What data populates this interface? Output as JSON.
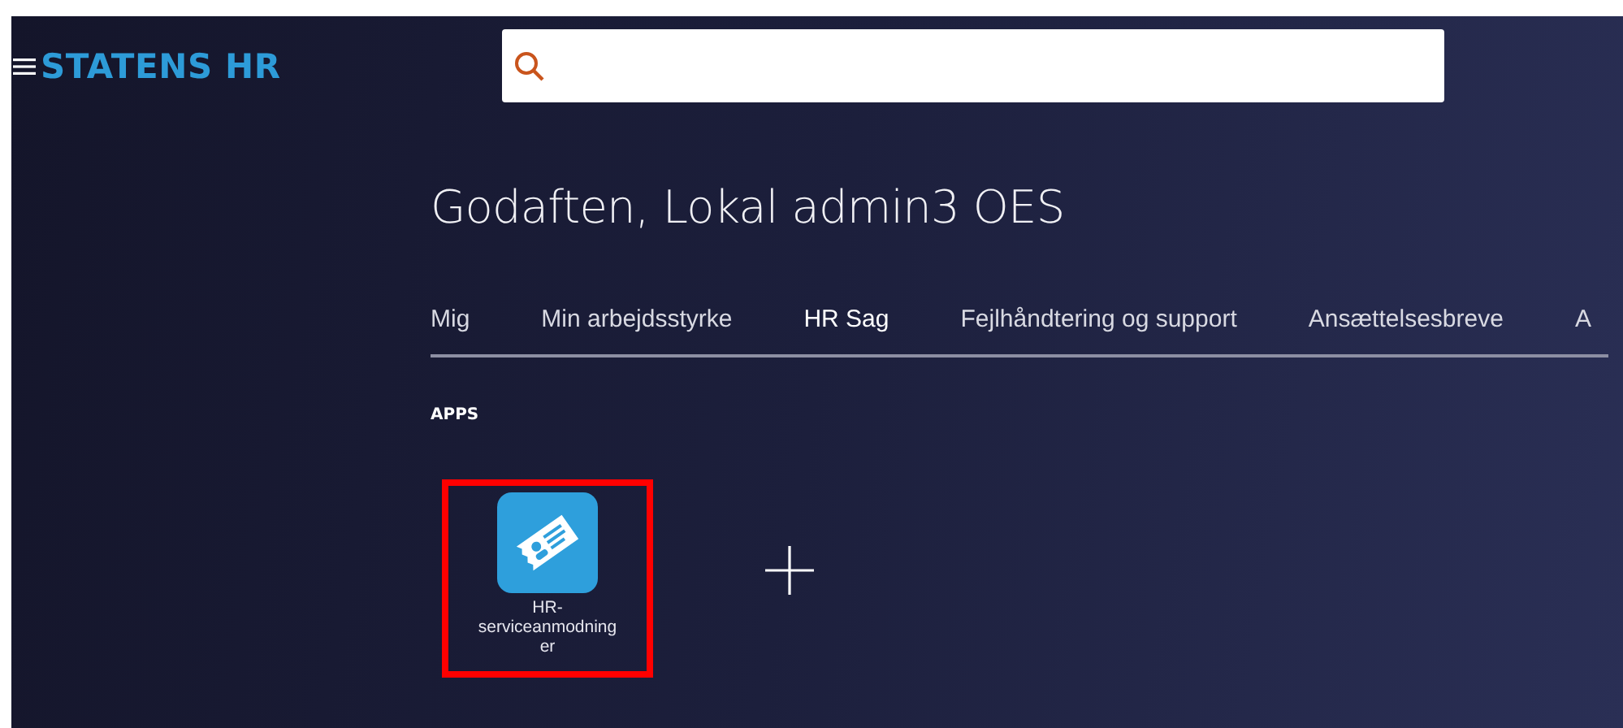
{
  "header": {
    "brand": "STATENS HR"
  },
  "greeting": "Godaften, Lokal admin3 OES",
  "tabs": [
    {
      "label": "Mig",
      "selected": false
    },
    {
      "label": "Min arbejdsstyrke",
      "selected": false
    },
    {
      "label": "HR Sag",
      "selected": true
    },
    {
      "label": "Fejlhåndtering og support",
      "selected": false
    },
    {
      "label": "Ansættelsesbreve",
      "selected": false
    },
    {
      "label": "A",
      "selected": false
    }
  ],
  "section_title": "APPS",
  "apps": [
    {
      "label": "HR-serviceanmodninger",
      "highlighted": true
    }
  ]
}
